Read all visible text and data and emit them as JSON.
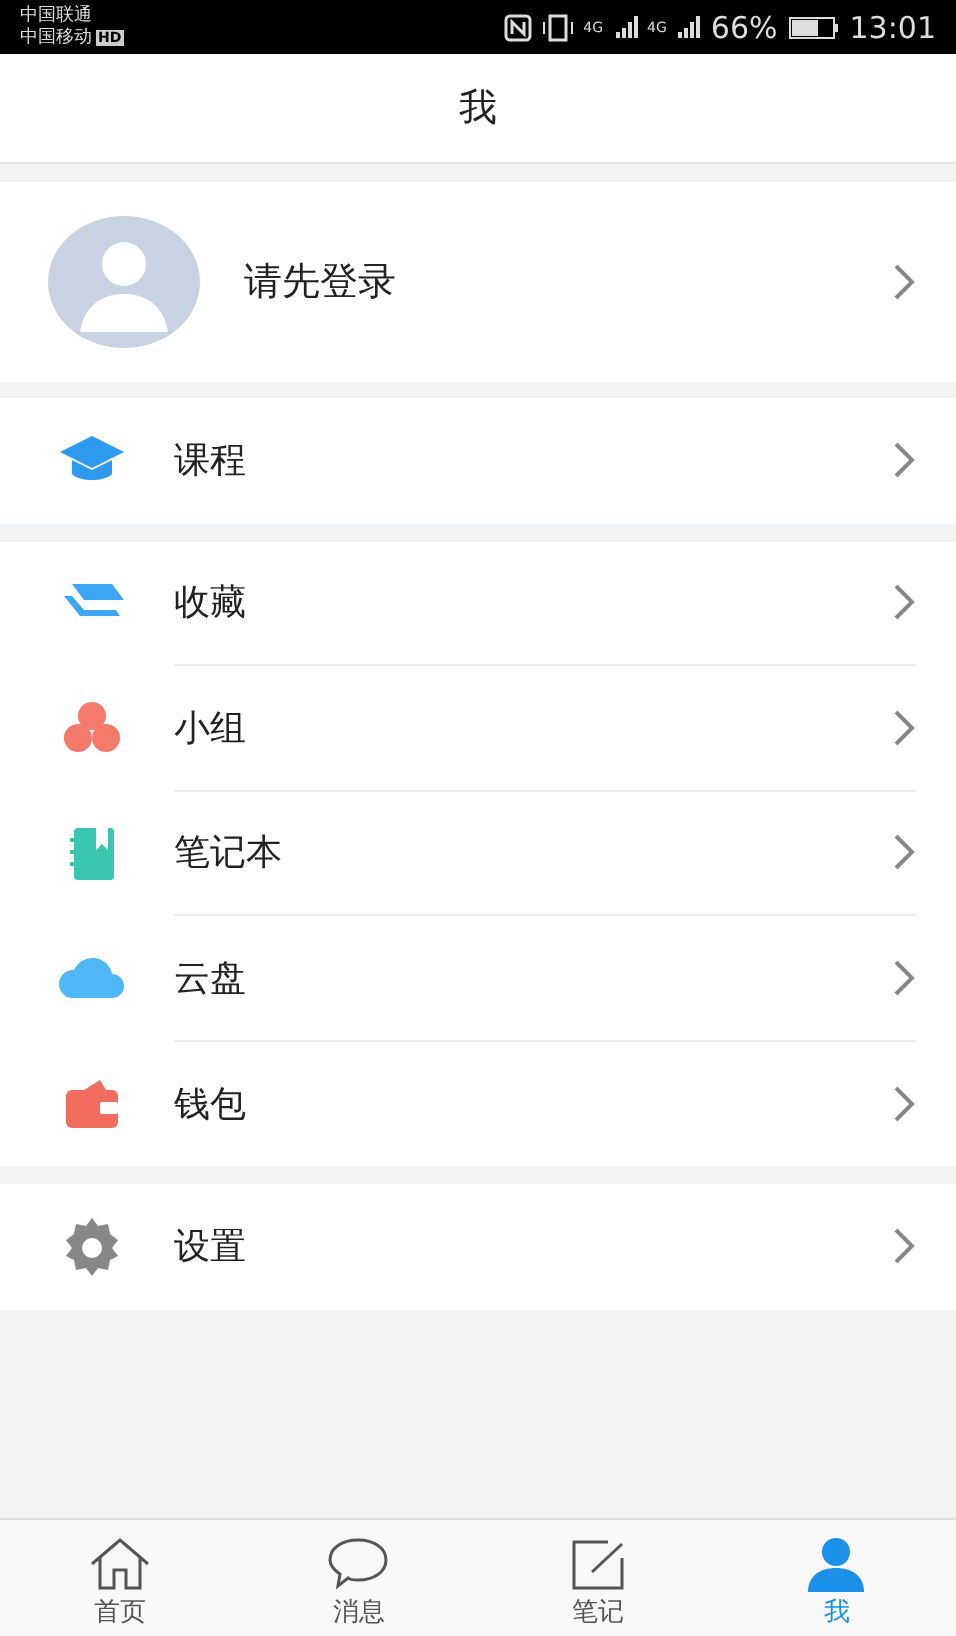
{
  "status_bar": {
    "carriers": [
      {
        "name": "中国联通"
      },
      {
        "name": "中国移动",
        "badge": "HD"
      }
    ],
    "networks": [
      "4G",
      "4G"
    ],
    "battery": "66%",
    "time": "13:01"
  },
  "header": {
    "title": "我"
  },
  "profile": {
    "label": "请先登录"
  },
  "sections": [
    {
      "items": [
        {
          "kind": "cap",
          "label": "课程"
        }
      ]
    },
    {
      "items": [
        {
          "kind": "layers",
          "label": "收藏"
        },
        {
          "kind": "group",
          "label": "小组"
        },
        {
          "kind": "notebook",
          "label": "笔记本"
        },
        {
          "kind": "cloud",
          "label": "云盘"
        },
        {
          "kind": "wallet",
          "label": "钱包"
        }
      ]
    },
    {
      "items": [
        {
          "kind": "gear",
          "label": "设置"
        }
      ]
    }
  ],
  "tab_bar": [
    {
      "kind": "home",
      "label": "首页",
      "selected": false
    },
    {
      "kind": "chat",
      "label": "消息",
      "selected": false
    },
    {
      "kind": "note",
      "label": "笔记",
      "selected": false
    },
    {
      "kind": "person",
      "label": "我",
      "selected": true
    }
  ]
}
